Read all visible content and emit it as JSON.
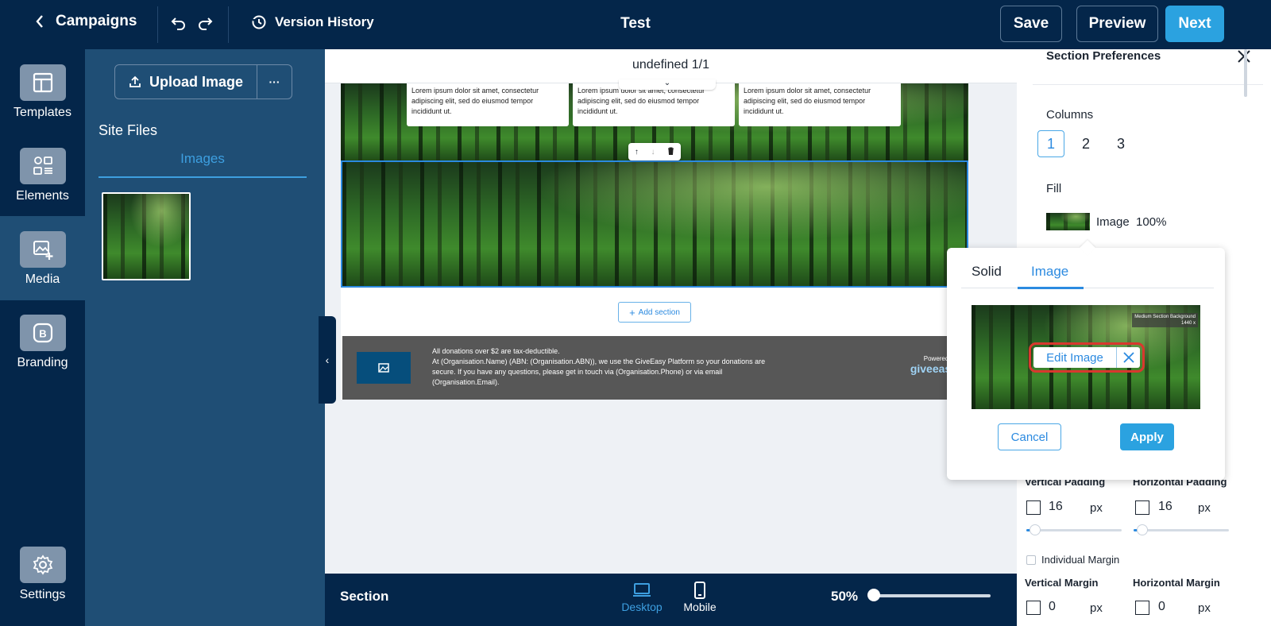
{
  "topbar": {
    "back_label": "Campaigns",
    "version_history": "Version History",
    "title": "Test",
    "save": "Save",
    "preview": "Preview",
    "next": "Next"
  },
  "rail": {
    "templates": "Templates",
    "elements": "Elements",
    "media": "Media",
    "branding": "Branding",
    "settings": "Settings"
  },
  "panel": {
    "upload": "Upload Image",
    "more": "···",
    "site_files": "Site Files",
    "tab": "Images"
  },
  "canvas": {
    "title": "undefined 1/1",
    "cards": [
      "Lorem ipsum dolor sit amet, consectetur adipiscing elit, sed do eiusmod tempor incididunt ut.",
      "Lorem ipsum dolor sit amet, consectetur adipiscing elit, sed do eiusmod tempor incididunt ut.",
      "Lorem ipsum dolor sit amet, consectetur adipiscing elit, sed do eiusmod tempor incididunt ut."
    ],
    "add_section": "Add section",
    "footer_line1": "All donations over $2 are tax-deductible.",
    "footer_line2": "At (Organisation.Name) (ABN: (Organisation.ABN)), we use the GiveEasy Platform so your donations are secure. If you have any questions, please get in touch via (Organisation.Phone) or via email (Organisation.Email).",
    "powered_by": "Powered by",
    "brand": "giveeasy"
  },
  "bottombar": {
    "section": "Section",
    "desktop": "Desktop",
    "mobile": "Mobile",
    "zoom": "50%",
    "zoom_value": 50
  },
  "prefs": {
    "title": "Section Preferences",
    "columns_label": "Columns",
    "columns": [
      "1",
      "2",
      "3"
    ],
    "columns_selected": "1",
    "fill_label": "Fill",
    "fill_type": "Image",
    "fill_opacity": "100%",
    "vertical_padding": "Vertical Padding",
    "horizontal_padding": "Horizontal Padding",
    "vpad_value": "16",
    "hpad_value": "16",
    "unit": "px",
    "individual_margin": "Individual Margin",
    "vertical_margin": "Vertical Margin",
    "horizontal_margin": "Horizontal Margin",
    "vmargin_value": "0",
    "hmargin_value": "0"
  },
  "popup": {
    "tab_solid": "Solid",
    "tab_image": "Image",
    "badge_line1": "Medium Section Background",
    "badge_line2": "1440 x",
    "edit_image": "Edit Image",
    "cancel": "Cancel",
    "apply": "Apply"
  },
  "colors": {
    "navy": "#04264a",
    "panel": "#1f4e75",
    "accent": "#2ba2e0",
    "highlight": "#d8382e"
  }
}
